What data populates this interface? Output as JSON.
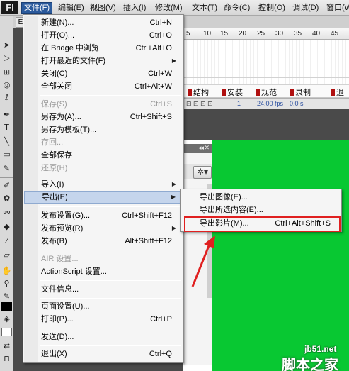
{
  "app": {
    "logo": "Fl"
  },
  "menubar": {
    "items": [
      {
        "label": "文件(F)"
      },
      {
        "label": "编辑(E)"
      },
      {
        "label": "视图(V)"
      },
      {
        "label": "插入(I)"
      },
      {
        "label": "修改(M)"
      },
      {
        "label": "文本(T)"
      },
      {
        "label": "命令(C)"
      },
      {
        "label": "控制(O)"
      },
      {
        "label": "调试(D)"
      },
      {
        "label": "窗口(W)"
      }
    ],
    "active": "文件(F)"
  },
  "file_menu": {
    "items": [
      {
        "label": "新建(N)...",
        "shortcut": "Ctrl+N",
        "enabled": true
      },
      {
        "label": "打开(O)...",
        "shortcut": "Ctrl+O",
        "enabled": true
      },
      {
        "label": "在 Bridge 中浏览",
        "shortcut": "Ctrl+Alt+O",
        "enabled": true
      },
      {
        "label": "打开最近的文件(F)",
        "shortcut": "",
        "submenu": true,
        "enabled": true
      },
      {
        "label": "关闭(C)",
        "shortcut": "Ctrl+W",
        "enabled": true
      },
      {
        "label": "全部关闭",
        "shortcut": "Ctrl+Alt+W",
        "enabled": true
      },
      {
        "label": "保存(S)",
        "shortcut": "Ctrl+S",
        "enabled": false
      },
      {
        "label": "另存为(A)...",
        "shortcut": "Ctrl+Shift+S",
        "enabled": true
      },
      {
        "label": "另存为模板(T)...",
        "shortcut": "",
        "enabled": true
      },
      {
        "label": "存回...",
        "shortcut": "",
        "enabled": false
      },
      {
        "label": "全部保存",
        "shortcut": "",
        "enabled": true
      },
      {
        "label": "还原(H)",
        "shortcut": "",
        "enabled": false
      },
      {
        "label": "导入(I)",
        "shortcut": "",
        "submenu": true,
        "enabled": true
      },
      {
        "label": "导出(E)",
        "shortcut": "",
        "submenu": true,
        "enabled": true,
        "highlighted": true
      },
      {
        "label": "发布设置(G)...",
        "shortcut": "Ctrl+Shift+F12",
        "enabled": true
      },
      {
        "label": "发布预览(R)",
        "shortcut": "",
        "submenu": true,
        "enabled": true
      },
      {
        "label": "发布(B)",
        "shortcut": "Alt+Shift+F12",
        "enabled": true
      },
      {
        "label": "AIR 设置...",
        "shortcut": "",
        "enabled": false
      },
      {
        "label": "ActionScript 设置...",
        "shortcut": "",
        "enabled": true
      },
      {
        "label": "文件信息...",
        "shortcut": "",
        "enabled": true
      },
      {
        "label": "页面设置(U)...",
        "shortcut": "",
        "enabled": true
      },
      {
        "label": "打印(P)...",
        "shortcut": "Ctrl+P",
        "enabled": true
      },
      {
        "label": "发送(D)...",
        "shortcut": "",
        "enabled": true
      },
      {
        "label": "退出(X)",
        "shortcut": "Ctrl+Q",
        "enabled": true
      }
    ]
  },
  "export_submenu": {
    "items": [
      {
        "label": "导出图像(E)...",
        "shortcut": ""
      },
      {
        "label": "导出所选内容(E)...",
        "shortcut": ""
      },
      {
        "label": "导出影片(M)...",
        "shortcut": "Ctrl+Alt+Shift+S",
        "boxed": true
      }
    ]
  },
  "timeline": {
    "ruler": [
      "5",
      "10",
      "15",
      "20",
      "25",
      "30",
      "35",
      "40",
      "45"
    ],
    "frame_labels": [
      "结构",
      "安装",
      "规范",
      "录制",
      "退"
    ],
    "fps": "24.00 fps",
    "time": "0.0 s",
    "frame": "1"
  },
  "tabs": {
    "doc_tab": "E"
  },
  "watermark": {
    "url": "jb51.net",
    "name": "脚本之家"
  },
  "colors": {
    "stage": "#08c832",
    "menu_highlight": "#c5d5ec",
    "annotation": "#e02020"
  },
  "icons": [
    "arrow-tool-icon",
    "subselect-tool-icon",
    "free-transform-icon",
    "3d-rotation-icon",
    "lasso-icon",
    "pen-icon",
    "text-icon",
    "line-icon",
    "rectangle-icon",
    "pencil-icon",
    "brush-icon",
    "deco-icon",
    "bone-icon",
    "paint-bucket-icon",
    "eyedropper-icon",
    "eraser-icon",
    "hand-icon",
    "zoom-icon",
    "stroke-color-icon",
    "fill-color-icon",
    "gear-icon"
  ]
}
